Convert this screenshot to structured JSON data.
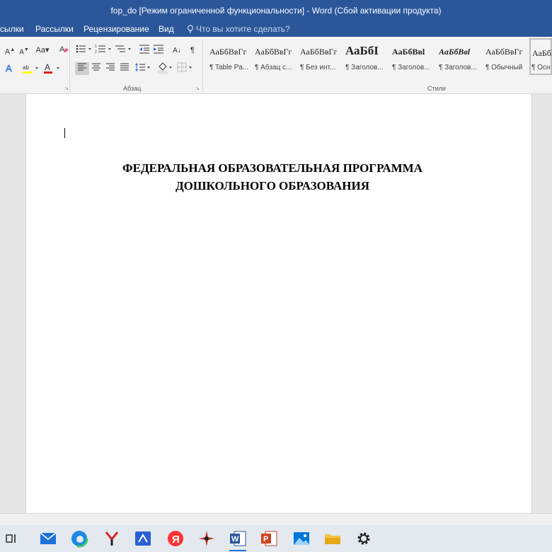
{
  "window": {
    "title": "fop_do [Режим ограниченной функциональности] - Word (Сбой активации продукта)"
  },
  "ribbon_tabs": [
    "сылки",
    "Рассылки",
    "Рецензирование",
    "Вид"
  ],
  "tell_me": {
    "placeholder": "Что вы хотите сделать?"
  },
  "ribbon": {
    "group_paragraph_label": "Абзац",
    "group_styles_label": "Стили",
    "font_grow": "A",
    "font_shrink": "A",
    "change_case": "Aa",
    "pilcrow": "¶",
    "sort": "A↓"
  },
  "styles": [
    {
      "sample": "АаБбВвГг",
      "name": "¶ Table Pa..."
    },
    {
      "sample": "АаБбВвГг",
      "name": "¶ Абзац с..."
    },
    {
      "sample": "АаБбВвГг",
      "name": "¶ Без инт..."
    },
    {
      "sample": "АаБбI",
      "name": "¶ Заголов..."
    },
    {
      "sample": "АаБбВвl",
      "name": "¶ Заголов..."
    },
    {
      "sample": "АаБбВвl",
      "name": "¶ Заголов..."
    },
    {
      "sample": "АаБбВвГг",
      "name": "¶ Обычный"
    },
    {
      "sample": "АаБбВвГг",
      "name": "¶ Осн"
    }
  ],
  "document": {
    "title_line1": "ФЕДЕРАЛЬНАЯ ОБРАЗОВАТЕЛЬНАЯ ПРОГРАММА",
    "title_line2": "ДОШКОЛЬНОГО ОБРАЗОВАНИЯ"
  },
  "taskbar": {
    "items": [
      "task-view",
      "mail",
      "edge",
      "yandex-browser",
      "mail-app",
      "yandex",
      "app",
      "word",
      "powerpoint",
      "photos",
      "file-explorer",
      "settings"
    ],
    "active": "word"
  },
  "colors": {
    "title_bar": "#2b579a",
    "word_blue": "#2b579a",
    "ribbon_bg": "#f3f3f3",
    "page_bg": "#ffffff",
    "canvas_bg": "#e6e6e6",
    "taskbar_bg": "#e4e9f0"
  }
}
